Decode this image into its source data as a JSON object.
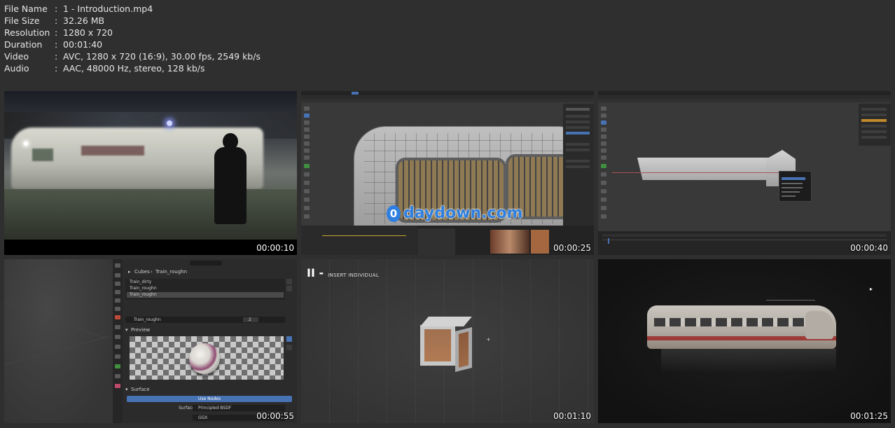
{
  "file_info": [
    {
      "key": "File Name",
      "value": "1 - Introduction.mp4"
    },
    {
      "key": "File Size",
      "value": "32.26 MB"
    },
    {
      "key": "Resolution",
      "value": "1280 x 720"
    },
    {
      "key": "Duration",
      "value": "00:01:40"
    },
    {
      "key": "Video",
      "value": "AVC, 1280 x 720 (16:9), 30.00 fps, 2549 kb/s"
    },
    {
      "key": "Audio",
      "value": "AAC, 48000 Hz, stereo, 128 kb/s"
    }
  ],
  "separator": ":",
  "thumbnails": [
    {
      "timestamp": "00:00:10"
    },
    {
      "timestamp": "00:00:25",
      "watermark": "daydown.com",
      "watermark_badge": "0"
    },
    {
      "timestamp": "00:00:40"
    },
    {
      "timestamp": "00:00:55",
      "breadcrumb": [
        "Cubes",
        "Train_roughn"
      ],
      "materials": [
        "Train_dirty",
        "Train_roughn",
        "Train_roughn"
      ],
      "selected_material_index": 2,
      "material_field": "Train_roughn",
      "material_users": "2",
      "preview_label": "Preview",
      "surface_label": "Surface",
      "use_nodes_button": "Use Nodes",
      "surface_field_label": "Surface",
      "surface_value": "Principled BSDF",
      "distribution_value": "GGX"
    },
    {
      "timestamp": "00:01:10",
      "title_prefix": "II -",
      "title": "INSERT INDIVIDUAL"
    },
    {
      "timestamp": "00:01:25"
    }
  ],
  "colors": {
    "background": "#2f2f2f",
    "text": "#e6e6e6",
    "use_nodes_blue": "#4772b3",
    "watermark_blue": "#2f7fe0"
  }
}
